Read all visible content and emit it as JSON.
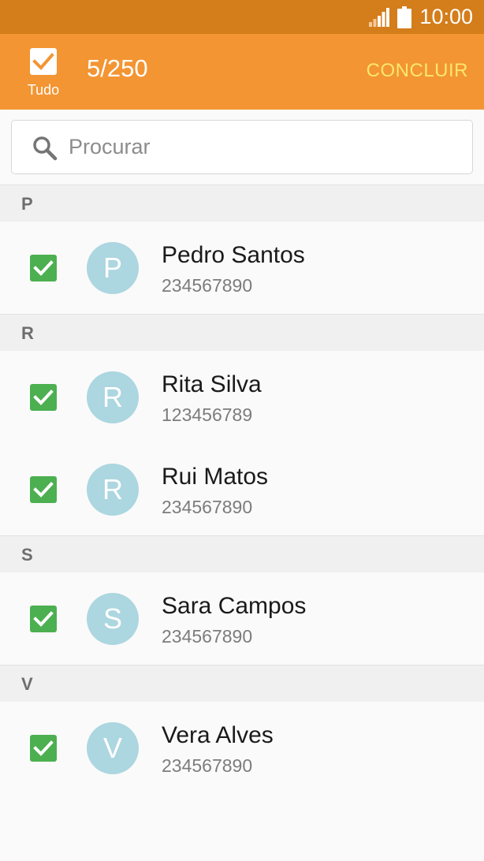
{
  "status_bar": {
    "time": "10:00",
    "signal_icon": "signal-icon",
    "battery_icon": "battery-icon"
  },
  "action_bar": {
    "select_all_label": "Tudo",
    "count": "5/250",
    "done_label": "CONCLUIR"
  },
  "search": {
    "placeholder": "Procurar",
    "value": ""
  },
  "sections": [
    {
      "letter": "P",
      "contacts": [
        {
          "initial": "P",
          "name": "Pedro Santos",
          "phone": "234567890",
          "checked": true
        }
      ]
    },
    {
      "letter": "R",
      "contacts": [
        {
          "initial": "R",
          "name": "Rita Silva",
          "phone": "123456789",
          "checked": true
        },
        {
          "initial": "R",
          "name": "Rui Matos",
          "phone": "234567890",
          "checked": true
        }
      ]
    },
    {
      "letter": "S",
      "contacts": [
        {
          "initial": "S",
          "name": "Sara Campos",
          "phone": "234567890",
          "checked": true
        }
      ]
    },
    {
      "letter": "V",
      "contacts": [
        {
          "initial": "V",
          "name": "Vera Alves",
          "phone": "234567890",
          "checked": true
        }
      ]
    }
  ],
  "colors": {
    "accent": "#f39533",
    "status_bar": "#d47d1b",
    "checkbox": "#4caf50",
    "avatar": "#acd6e0",
    "done": "#fbe76b"
  }
}
